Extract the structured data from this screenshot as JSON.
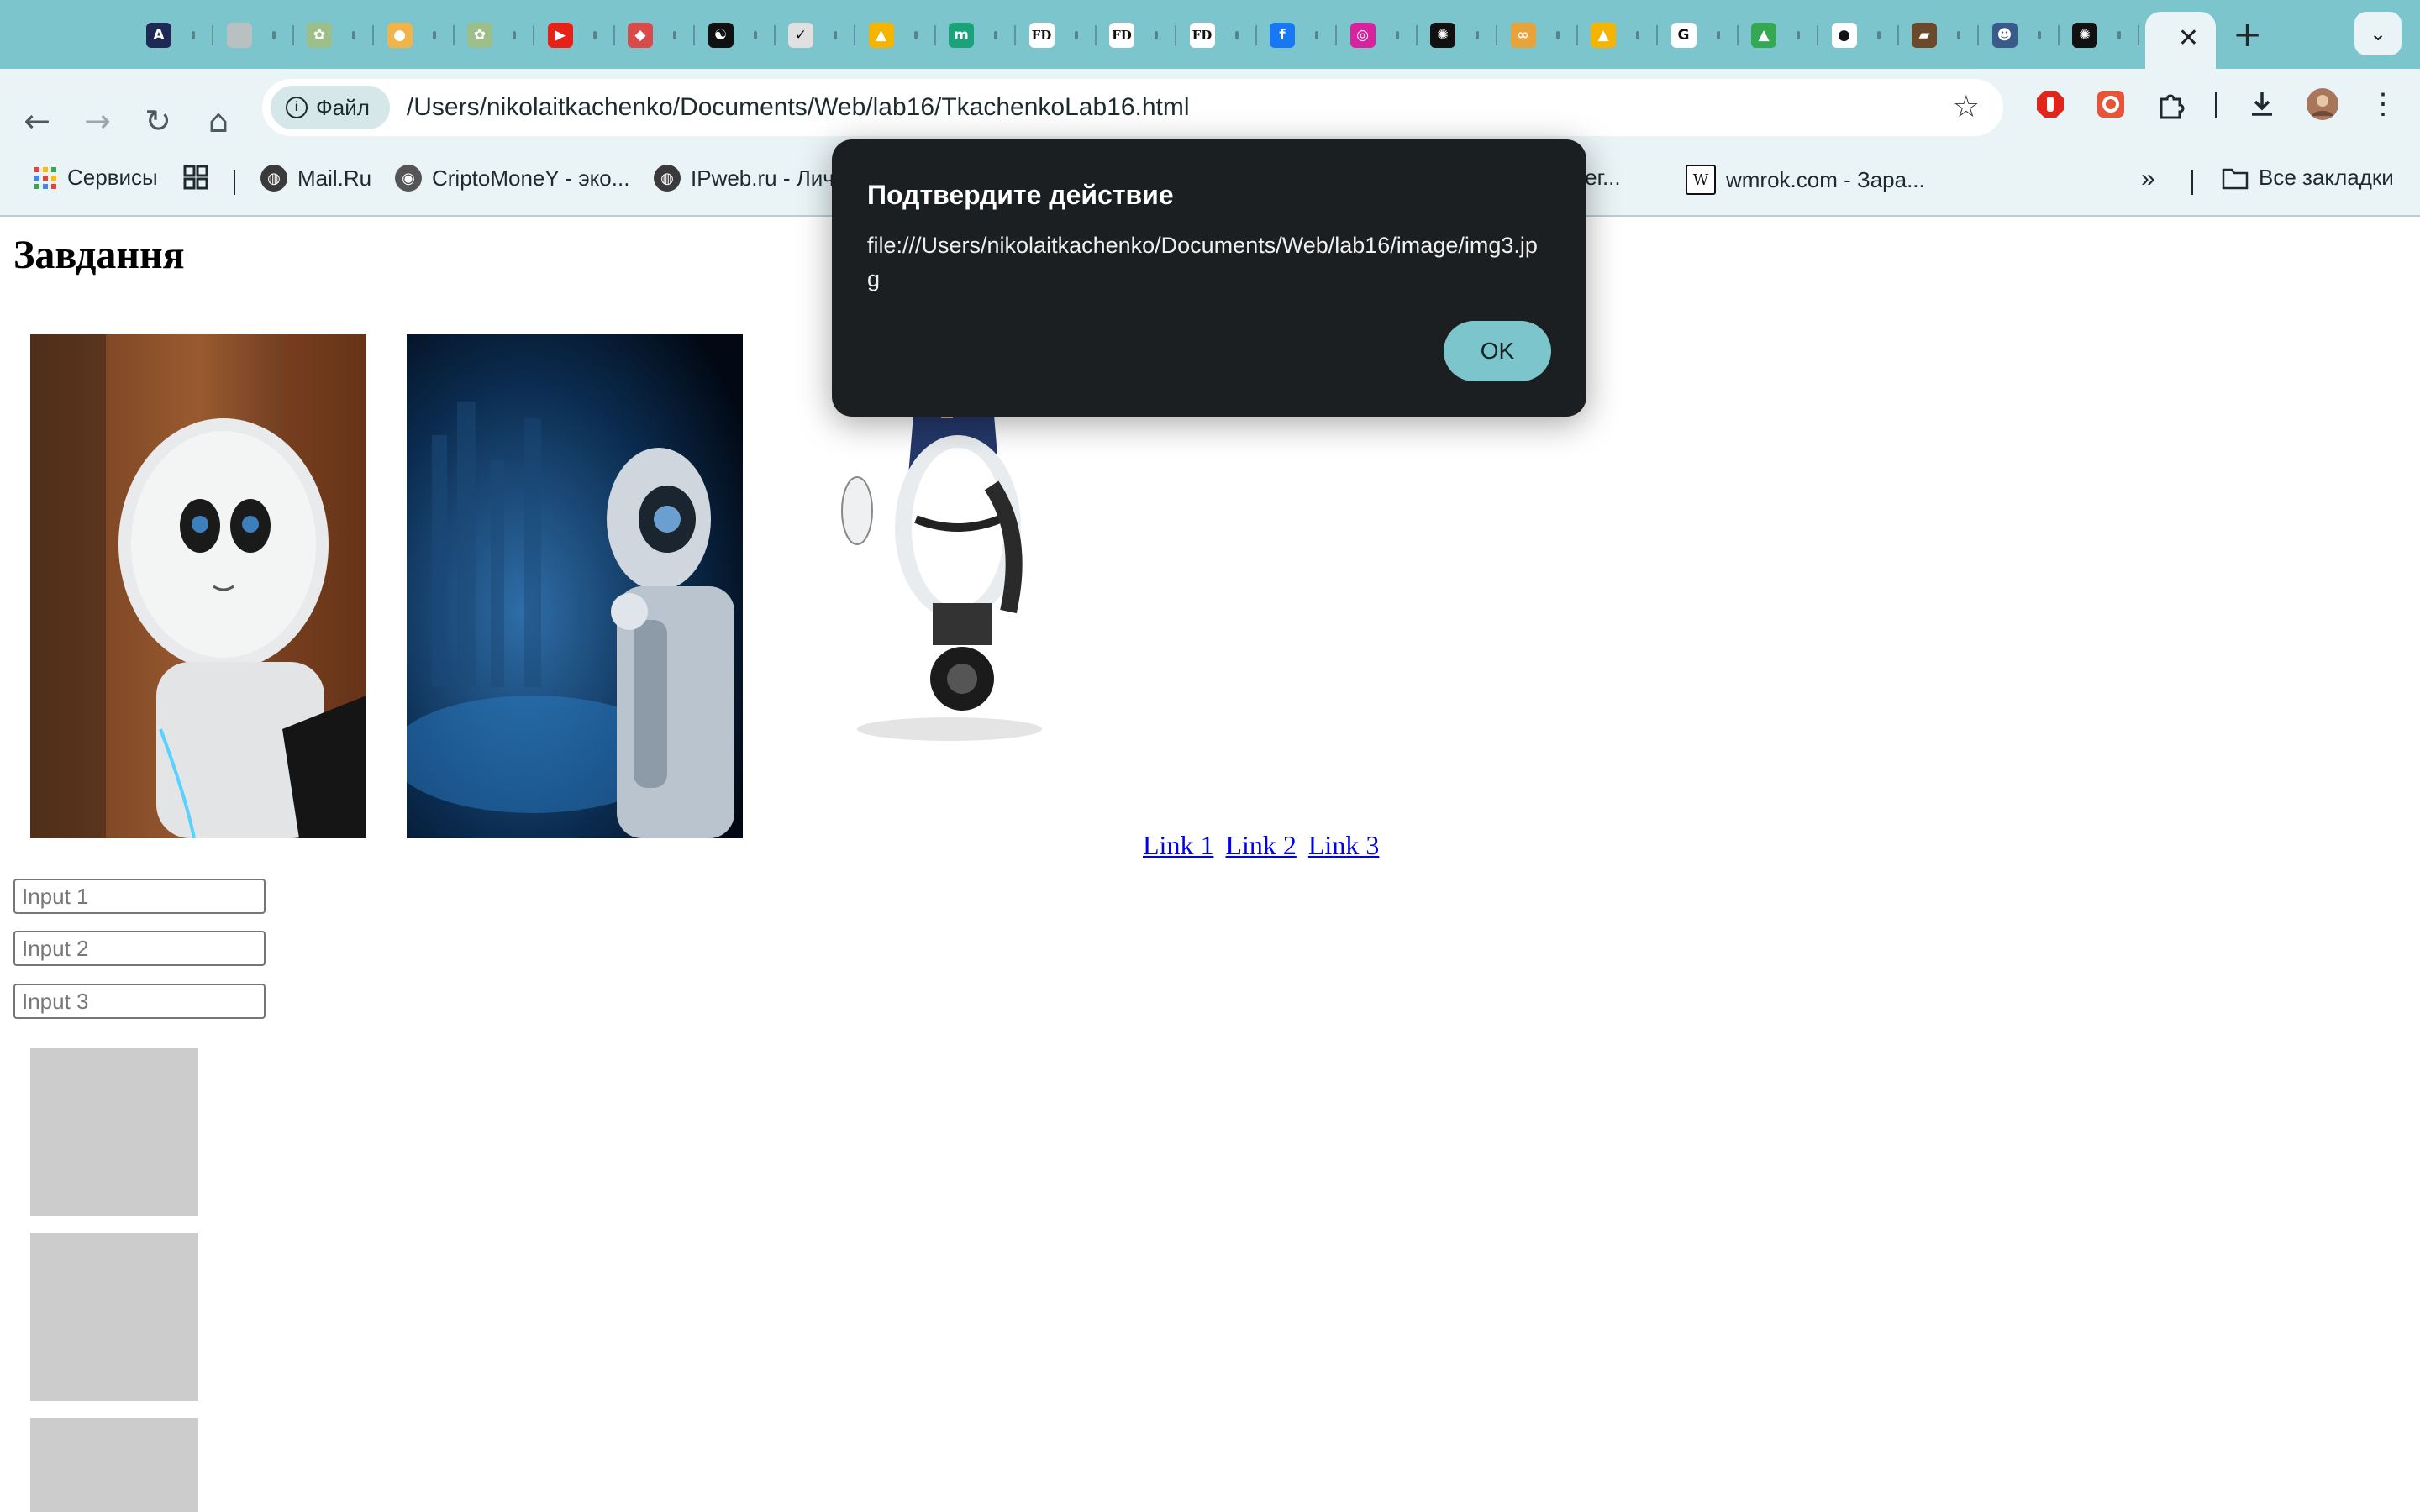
{
  "browser": {
    "tabs": [
      {
        "icon": "app-icon",
        "glyph": "A",
        "color": "#1c2a55"
      },
      {
        "icon": "circle-icon",
        "glyph": "",
        "color": "#b8c0c2"
      },
      {
        "icon": "flower-icon",
        "glyph": "✿",
        "color": "#9cbf8a"
      },
      {
        "icon": "chick-icon",
        "glyph": "●",
        "color": "#f2b44a"
      },
      {
        "icon": "flower-icon",
        "glyph": "✿",
        "color": "#9cbf8a"
      },
      {
        "icon": "youtube-icon",
        "glyph": "▶",
        "color": "#e62117"
      },
      {
        "icon": "shield-icon",
        "glyph": "◆",
        "color": "#d94a4a"
      },
      {
        "icon": "yin-yang-icon",
        "glyph": "☯",
        "color": "#111111"
      },
      {
        "icon": "bird-icon",
        "glyph": "✓",
        "color": "#e0e0e0"
      },
      {
        "icon": "google-drive-icon",
        "glyph": "▲",
        "color": "#f4b400"
      },
      {
        "icon": "m-icon",
        "glyph": "m",
        "color": "#1aa37a"
      },
      {
        "icon": "fd-icon",
        "glyph": "FD",
        "color": "#ffffff"
      },
      {
        "icon": "fd-icon",
        "glyph": "FD",
        "color": "#ffffff"
      },
      {
        "icon": "fd-icon",
        "glyph": "FD",
        "color": "#ffffff"
      },
      {
        "icon": "facebook-icon",
        "glyph": "f",
        "color": "#1877f2"
      },
      {
        "icon": "instagram-icon",
        "glyph": "◎",
        "color": "#d6249f"
      },
      {
        "icon": "chatgpt-icon",
        "glyph": "✺",
        "color": "#111111"
      },
      {
        "icon": "glasses-icon",
        "glyph": "∞",
        "color": "#e8a23a"
      },
      {
        "icon": "google-drive-icon",
        "glyph": "▲",
        "color": "#f4b400"
      },
      {
        "icon": "google-icon",
        "glyph": "G",
        "color": "#ffffff"
      },
      {
        "icon": "google-drive-icon",
        "glyph": "▲",
        "color": "#34a853"
      },
      {
        "icon": "github-icon",
        "glyph": "●",
        "color": "#ffffff"
      },
      {
        "icon": "cap-icon",
        "glyph": "▰",
        "color": "#6a4a2a"
      },
      {
        "icon": "owl-icon",
        "glyph": "☻",
        "color": "#3a5a8a"
      },
      {
        "icon": "chatgpt-icon",
        "glyph": "✺",
        "color": "#111111"
      }
    ],
    "file_chip": "Файл",
    "url": "/Users/nikolaitkachenko/Documents/Web/lab16/TkachenkoLab16.html",
    "bookmarks": {
      "services": "Сервисы",
      "items": [
        "Mail.Ru",
        "CriptoMoneY - эко...",
        "IPweb.ru - Лич",
        "| Рег...",
        "wmrok.com - Зара..."
      ],
      "all_bookmarks": "Все закладки"
    }
  },
  "page": {
    "heading": "Завдання",
    "links": [
      "Link 1",
      "Link 2",
      "Link 3"
    ],
    "inputs": [
      {
        "placeholder": "Input 1"
      },
      {
        "placeholder": "Input 2"
      },
      {
        "placeholder": "Input 3"
      }
    ]
  },
  "dialog": {
    "title": "Подтвердите действие",
    "message": "file:///Users/nikolaitkachenko/Documents/Web/lab16/image/img3.jpg",
    "ok_label": "OK"
  },
  "colors": {
    "tabstrip": "#7cc5cc",
    "toolbar": "#eaf4f6",
    "dialog_bg": "#1c1f21",
    "ok_button": "#7cc5cc",
    "link": "#0000ee",
    "placeholder_box": "#cccccc"
  }
}
